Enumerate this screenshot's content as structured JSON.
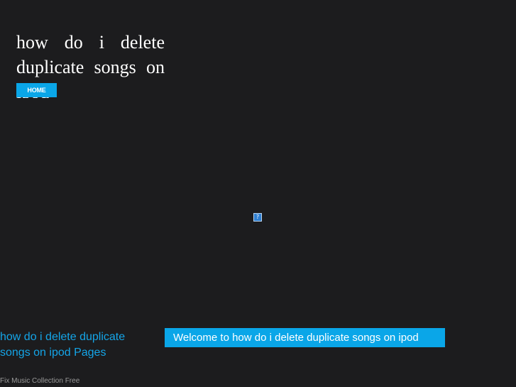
{
  "header": {
    "site_title": "how do i delete duplicate songs on ipod"
  },
  "nav": {
    "home_label": "HOME"
  },
  "main": {
    "broken_image_glyph": "?"
  },
  "sidebar": {
    "pages_heading": "how do i delete duplicate songs on ipod Pages"
  },
  "content": {
    "welcome_text": "Welcome to how do i delete duplicate songs on ipod"
  },
  "footer": {
    "link_text": "Fix Music Collection Free"
  },
  "colors": {
    "background": "#1c1c1e",
    "accent": "#0aa6e8",
    "link": "#14a5e8",
    "footer_text": "#9a9a9a"
  }
}
